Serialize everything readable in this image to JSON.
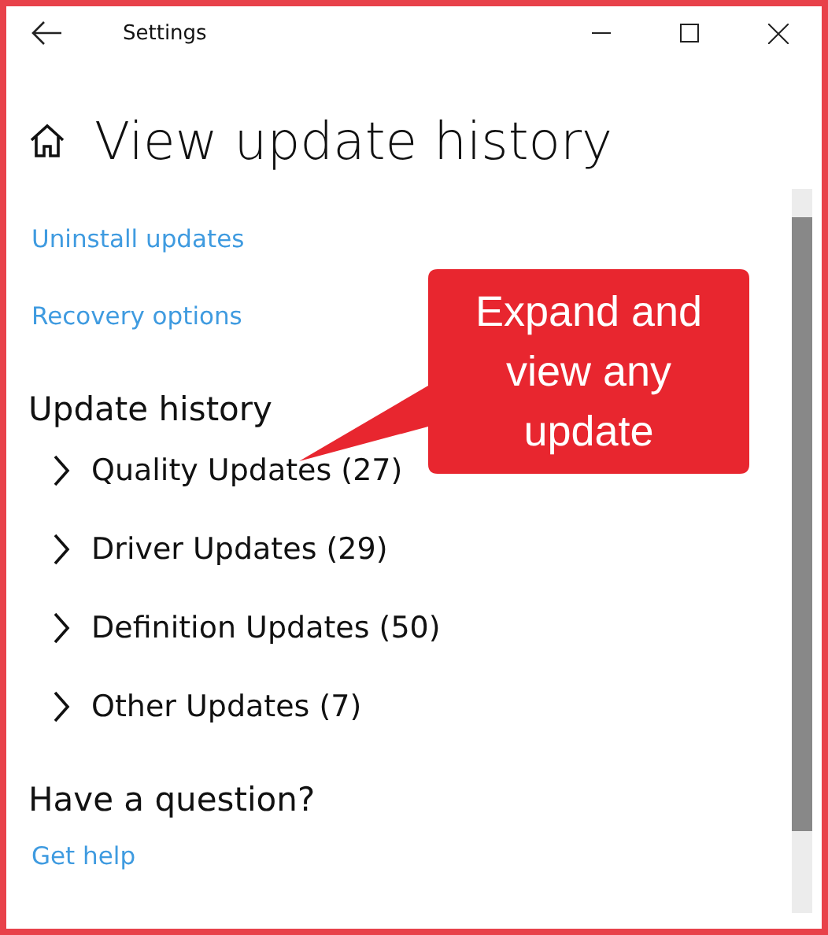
{
  "window": {
    "title": "Settings"
  },
  "page": {
    "title": "View update history"
  },
  "links": [
    "Uninstall updates",
    "Recovery options"
  ],
  "update_history": {
    "heading": "Update history",
    "groups": [
      {
        "label": "Quality Updates (27)",
        "expanded": false
      },
      {
        "label": "Driver Updates (29)",
        "expanded": false
      },
      {
        "label": "Definition Updates (50)",
        "expanded": false
      },
      {
        "label": "Other Updates (7)",
        "expanded": false
      }
    ]
  },
  "help": {
    "heading": "Have a question?",
    "link": "Get help"
  },
  "callout": {
    "text": "Expand and view any update"
  }
}
